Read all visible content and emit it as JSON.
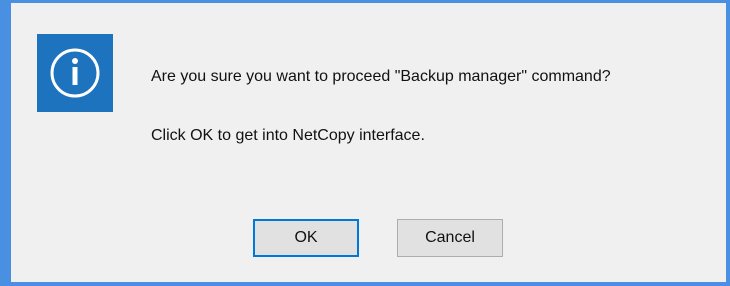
{
  "dialog": {
    "icon": "info-icon",
    "message_line1": "Are you sure you want to proceed \"Backup manager\" command?",
    "message_line2": "Click OK to get into NetCopy interface.",
    "buttons": {
      "ok_label": "OK",
      "cancel_label": "Cancel"
    }
  },
  "colors": {
    "accent": "#4a90e2",
    "icon_bg": "#1e73be",
    "dialog_bg": "#f0f0f0",
    "default_button_border": "#0078d7"
  }
}
